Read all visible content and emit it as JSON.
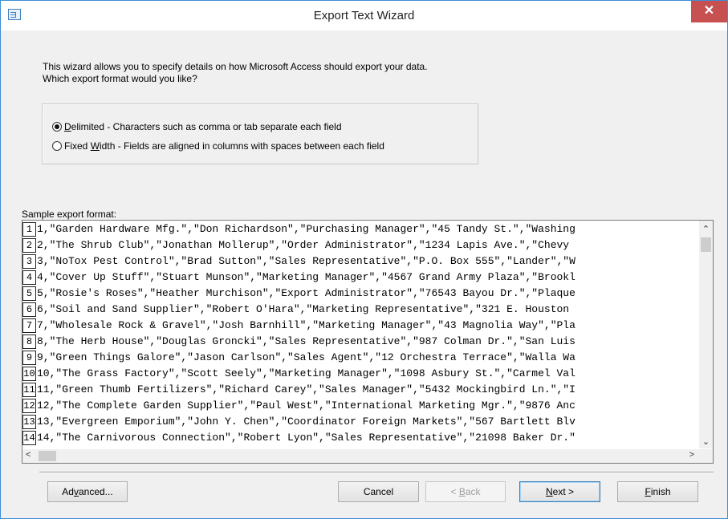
{
  "window": {
    "title": "Export Text Wizard",
    "close_glyph": "✕"
  },
  "intro": {
    "line1": "This wizard allows you to specify details on how Microsoft Access should export your data.",
    "line2": "Which export format would you like?"
  },
  "format_options": [
    {
      "mnemonic": "D",
      "rest": "elimited - Characters such as comma or tab separate each field",
      "selected": true
    },
    {
      "pre": "Fixed ",
      "mnemonic": "W",
      "rest": "idth - Fields are aligned in columns with spaces between each field",
      "selected": false
    }
  ],
  "sample": {
    "label": "Sample export format:",
    "rows": [
      {
        "n": "1",
        "text": "1,\"Garden Hardware Mfg.\",\"Don Richardson\",\"Purchasing Manager\",\"45 Tandy St.\",\"Washing"
      },
      {
        "n": "2",
        "text": "2,\"The Shrub Club\",\"Jonathan Mollerup\",\"Order Administrator\",\"1234 Lapis Ave.\",\"Chevy"
      },
      {
        "n": "3",
        "text": "3,\"NoTox Pest Control\",\"Brad Sutton\",\"Sales Representative\",\"P.O. Box 555\",\"Lander\",\"W"
      },
      {
        "n": "4",
        "text": "4,\"Cover Up Stuff\",\"Stuart Munson\",\"Marketing Manager\",\"4567 Grand Army Plaza\",\"Brookl"
      },
      {
        "n": "5",
        "text": "5,\"Rosie's Roses\",\"Heather Murchison\",\"Export Administrator\",\"76543 Bayou Dr.\",\"Plaque"
      },
      {
        "n": "6",
        "text": "6,\"Soil and Sand Supplier\",\"Robert O'Hara\",\"Marketing Representative\",\"321 E. Houston"
      },
      {
        "n": "7",
        "text": "7,\"Wholesale Rock & Gravel\",\"Josh Barnhill\",\"Marketing Manager\",\"43 Magnolia Way\",\"Pla"
      },
      {
        "n": "8",
        "text": "8,\"The Herb House\",\"Douglas Groncki\",\"Sales Representative\",\"987 Colman Dr.\",\"San Luis"
      },
      {
        "n": "9",
        "text": "9,\"Green Things Galore\",\"Jason Carlson\",\"Sales Agent\",\"12 Orchestra Terrace\",\"Walla Wa"
      },
      {
        "n": "10",
        "text": "10,\"The Grass Factory\",\"Scott Seely\",\"Marketing Manager\",\"1098 Asbury St.\",\"Carmel Val"
      },
      {
        "n": "11",
        "text": "11,\"Green Thumb Fertilizers\",\"Richard Carey\",\"Sales Manager\",\"5432 Mockingbird Ln.\",\"I"
      },
      {
        "n": "12",
        "text": "12,\"The Complete Garden Supplier\",\"Paul West\",\"International Marketing Mgr.\",\"9876 Anc"
      },
      {
        "n": "13",
        "text": "13,\"Evergreen Emporium\",\"John Y. Chen\",\"Coordinator Foreign Markets\",\"567 Bartlett Blv"
      },
      {
        "n": "14",
        "text": "14,\"The Carnivorous Connection\",\"Robert Lyon\",\"Sales Representative\",\"21098 Baker Dr.\""
      }
    ]
  },
  "buttons": {
    "advanced": {
      "pre": "Ad",
      "mnemonic": "v",
      "rest": "anced..."
    },
    "cancel": {
      "label": "Cancel"
    },
    "back": {
      "pre": "< ",
      "mnemonic": "B",
      "rest": "ack"
    },
    "next": {
      "mnemonic": "N",
      "rest": "ext >"
    },
    "finish": {
      "mnemonic": "F",
      "rest": "inish"
    }
  },
  "scroll_glyphs": {
    "up": "⌃",
    "down": "⌄",
    "left": "<",
    "right": ">"
  }
}
